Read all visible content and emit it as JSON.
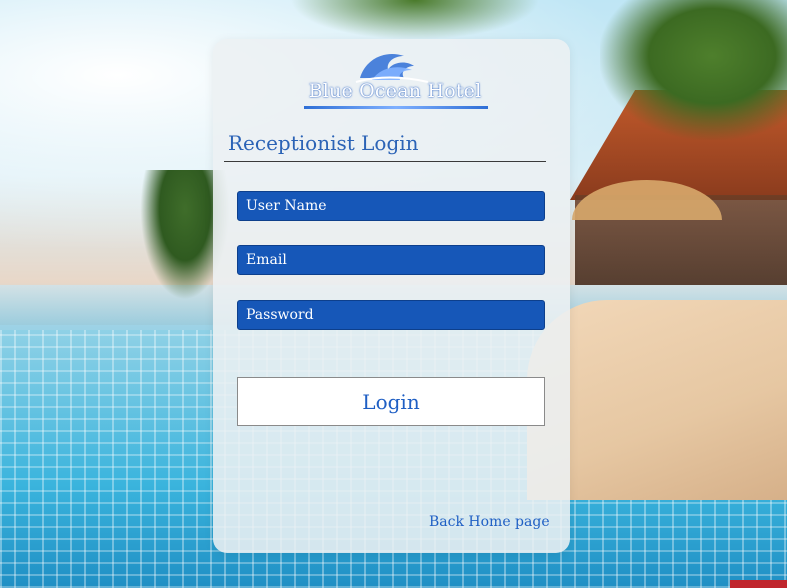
{
  "brand": {
    "logo_text": "Blue Ocean Hotel",
    "logo_icon": "wave-icon",
    "primary_color": "#1657b8",
    "accent_text_color": "#2b63b6"
  },
  "page": {
    "title": "Receptionist Login"
  },
  "form": {
    "username_placeholder": "User Name",
    "email_placeholder": "Email",
    "password_placeholder": "Password",
    "login_label": "Login"
  },
  "nav": {
    "back_home_label": "Back Home page"
  }
}
